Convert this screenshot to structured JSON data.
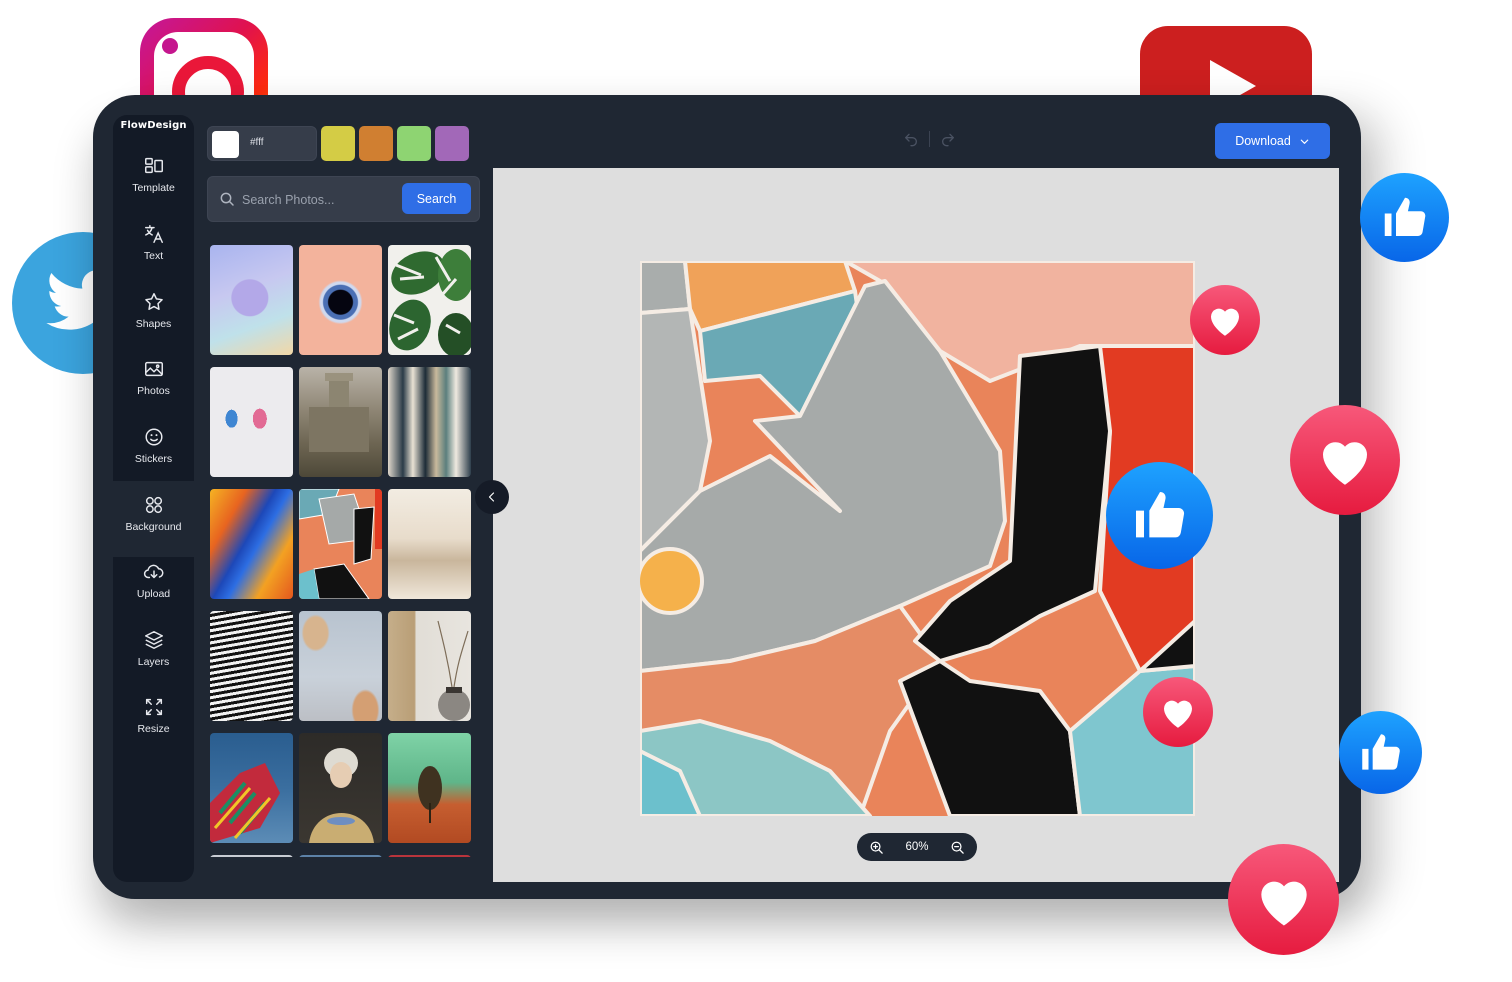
{
  "app": {
    "brand": "FlowDesign"
  },
  "sidebar": {
    "items": [
      {
        "label": "Template",
        "icon": "template-icon"
      },
      {
        "label": "Text",
        "icon": "translate-text-icon"
      },
      {
        "label": "Shapes",
        "icon": "star-icon"
      },
      {
        "label": "Photos",
        "icon": "image-icon"
      },
      {
        "label": "Stickers",
        "icon": "smiley-icon"
      },
      {
        "label": "Background",
        "icon": "grid-circles-icon"
      },
      {
        "label": "Upload",
        "icon": "cloud-upload-icon"
      },
      {
        "label": "Layers",
        "icon": "layers-icon"
      },
      {
        "label": "Resize",
        "icon": "resize-icon"
      }
    ]
  },
  "panel": {
    "color_value": "#fff",
    "swatches": [
      "#d4cc45",
      "#d07f31",
      "#8ed472",
      "#a268b8"
    ],
    "search": {
      "placeholder": "Search Photos...",
      "value": "",
      "button_label": "Search"
    },
    "photos": [
      {
        "title": "pastel-sphere"
      },
      {
        "title": "black-hole-paint"
      },
      {
        "title": "monstera-leaves"
      },
      {
        "title": "paint-dabs"
      },
      {
        "title": "castle-painting"
      },
      {
        "title": "abstract-brush"
      },
      {
        "title": "fluid-art"
      },
      {
        "title": "mural-feet"
      },
      {
        "title": "city-sketch"
      },
      {
        "title": "op-art-figure"
      },
      {
        "title": "sky-fresco"
      },
      {
        "title": "vase-branches"
      },
      {
        "title": "painted-hand"
      },
      {
        "title": "classic-portrait"
      },
      {
        "title": "lone-tree"
      }
    ]
  },
  "toolbar": {
    "download_label": "Download"
  },
  "canvas": {
    "zoom_level": "60%"
  },
  "colors": {
    "accent": "#2f6ee6",
    "frame": "#1f2733",
    "sidebar": "#131a26",
    "canvas_bg": "#dedede"
  },
  "decorations": [
    "instagram-logo",
    "youtube-logo",
    "twitter-logo",
    "like-reaction",
    "love-reaction"
  ]
}
